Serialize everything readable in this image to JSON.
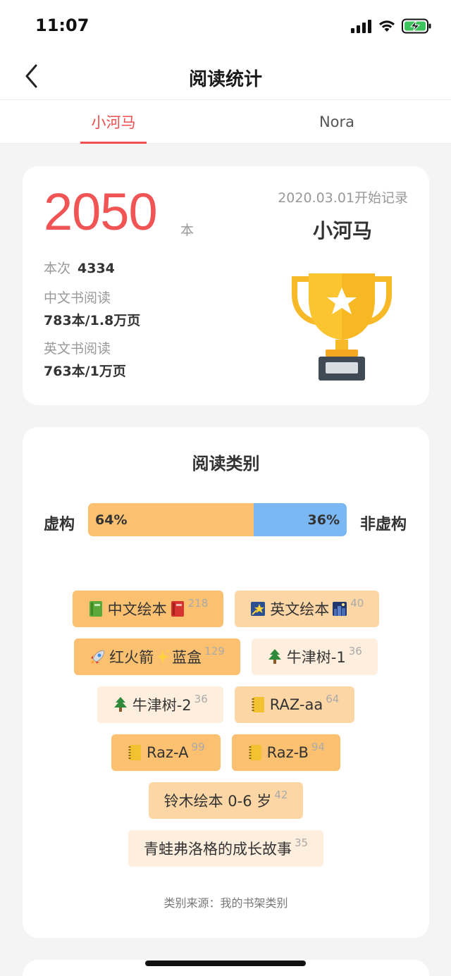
{
  "status_bar": {
    "time": "11:07"
  },
  "nav": {
    "title": "阅读统计"
  },
  "tabs": [
    {
      "label": "小河马",
      "active": true
    },
    {
      "label": "Nora",
      "active": false
    }
  ],
  "summary": {
    "total": "2050",
    "total_unit": "本",
    "session_label": "本次",
    "session_value": "4334",
    "chinese_label": "中文书阅读",
    "chinese_value": "783本/1.8万页",
    "english_label": "英文书阅读",
    "english_value": "763本/1万页",
    "start_date": "2020.03.01开始记录",
    "owner": "小河马"
  },
  "category": {
    "title": "阅读类别",
    "fiction_label": "虚构",
    "nonfiction_label": "非虚构",
    "fiction_pct": "64%",
    "nonfiction_pct": "36%",
    "fiction_fraction": 0.64,
    "tags": [
      {
        "icon": "green-book-icon",
        "label": "中文绘本",
        "icon2": "red-book-icon",
        "count": "218",
        "level": 3
      },
      {
        "icon": "shooting-star-icon",
        "label": "英文绘本",
        "icon2": "night-city-icon",
        "count": "40",
        "level": 2
      },
      {
        "icon": "rocket-icon",
        "label": "红火箭",
        "icon2": "sparkles-icon",
        "label2": "蓝盒",
        "count": "129",
        "level": 3
      },
      {
        "icon": "tree-icon",
        "label": "牛津树-1",
        "count": "36",
        "level": 1
      },
      {
        "icon": "tree-icon",
        "label": "牛津树-2",
        "count": "36",
        "level": 1
      },
      {
        "icon": "notebook-icon",
        "label": "RAZ-aa",
        "count": "64",
        "level": 2
      },
      {
        "icon": "notebook-icon",
        "label": "Raz-A",
        "count": "99",
        "level": 3
      },
      {
        "icon": "notebook-icon",
        "label": "Raz-B",
        "count": "94",
        "level": 3
      },
      {
        "label": "铃木绘本 0-6 岁",
        "count": "42",
        "level": 2
      },
      {
        "label": "青蛙弗洛格的成长故事",
        "count": "35",
        "level": 1
      }
    ],
    "source_note": "类别来源：我的书架类别"
  },
  "colors": {
    "accent": "#ef4f4f",
    "fiction": "#fbc171",
    "nonfiction": "#7ab7f3"
  }
}
